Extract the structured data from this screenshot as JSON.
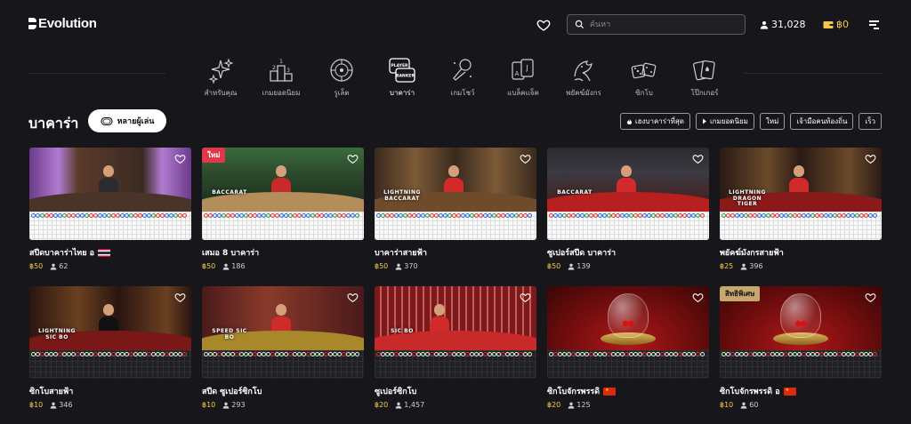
{
  "brand": "Evolution",
  "header": {
    "search_placeholder": "ค้นหา",
    "players": "31,028",
    "balance": "฿0"
  },
  "categories": [
    {
      "label": "สำหรับคุณ",
      "icon": "sparkles-icon",
      "active": false
    },
    {
      "label": "เกมยอดนิยม",
      "icon": "podium-icon",
      "active": false
    },
    {
      "label": "รูเล็ต",
      "icon": "roulette-icon",
      "active": false
    },
    {
      "label": "บาคาร่า",
      "icon": "baccarat-icon",
      "active": true,
      "icon_text": [
        "PLAYER",
        "BANKER"
      ]
    },
    {
      "label": "เกมโชว์",
      "icon": "microphone-icon",
      "active": false
    },
    {
      "label": "แบล็คแจ็ค",
      "icon": "blackjack-cards-icon",
      "active": false
    },
    {
      "label": "พยัคฆ์มังกร",
      "icon": "dragon-tiger-icon",
      "active": false
    },
    {
      "label": "ซิกโบ",
      "icon": "dice-icon",
      "active": false
    },
    {
      "label": "โป๊กเกอร์",
      "icon": "poker-cards-icon",
      "active": false
    }
  ],
  "section": {
    "title": "บาคาร่า",
    "multi_play_label": "หลายผู้เล่น"
  },
  "filters": [
    {
      "label": "เฮงบาคาร่าที่สุด",
      "icon": "flame-icon"
    },
    {
      "label": "เกมยอดนิยม",
      "icon": "chevron-icon"
    },
    {
      "label": "ใหม่",
      "icon": ""
    },
    {
      "label": "เจ้ามือคนท้องถิ่น",
      "icon": ""
    },
    {
      "label": "เร็ว",
      "icon": ""
    }
  ],
  "games": [
    {
      "title": "สปีดบาคาร่าไทย อ",
      "bet": "฿50",
      "players": "62",
      "flag": "th",
      "badge": "",
      "theme": "thai",
      "logo": ""
    },
    {
      "title": "เสมอ 8 บาคาร่า",
      "bet": "฿50",
      "players": "186",
      "flag": "",
      "badge": "ใหม่",
      "theme": "green",
      "logo": "BACCARAT"
    },
    {
      "title": "บาคาร่าสายฟ้า",
      "bet": "฿50",
      "players": "370",
      "flag": "",
      "badge": "",
      "theme": "gold",
      "logo": "LIGHTNING BACCARAT"
    },
    {
      "title": "ซูเปอร์สปีด บาคาร่า",
      "bet": "฿50",
      "players": "139",
      "flag": "",
      "badge": "",
      "theme": "red",
      "logo": "BACCARAT"
    },
    {
      "title": "พยัคฆ์มังกรสายฟ้า",
      "bet": "฿25",
      "players": "396",
      "flag": "",
      "badge": "",
      "theme": "darkred",
      "logo": "LIGHTNING DRAGON TIGER"
    },
    {
      "title": "ซิกโบสายฟ้า",
      "bet": "฿10",
      "players": "346",
      "flag": "",
      "badge": "",
      "theme": "sicbo1",
      "logo": "LIGHTNING SIC BO"
    },
    {
      "title": "สปีด ซูเปอร์ซิกโบ",
      "bet": "฿10",
      "players": "293",
      "flag": "",
      "badge": "",
      "theme": "sicbo2",
      "logo": "SPEED SIC BO"
    },
    {
      "title": "ซูเปอร์ซิกโบ",
      "bet": "฿20",
      "players": "1,457",
      "flag": "",
      "badge": "",
      "theme": "sicbo3",
      "logo": "SIC BO"
    },
    {
      "title": "ซิกโบจักรพรรดิ",
      "bet": "฿20",
      "players": "125",
      "flag": "cn",
      "badge": "",
      "theme": "dome",
      "logo": ""
    },
    {
      "title": "ซิกโบจักรพรรดิ อ",
      "bet": "฿10",
      "players": "60",
      "flag": "cn",
      "badge": "สิทธิพิเศษ",
      "theme": "dome",
      "logo": ""
    }
  ],
  "colors": {
    "background": "#17171b",
    "accent_gold": "#f2c94c",
    "badge_new": "#e0384a",
    "badge_vip": "#c6a76e"
  }
}
